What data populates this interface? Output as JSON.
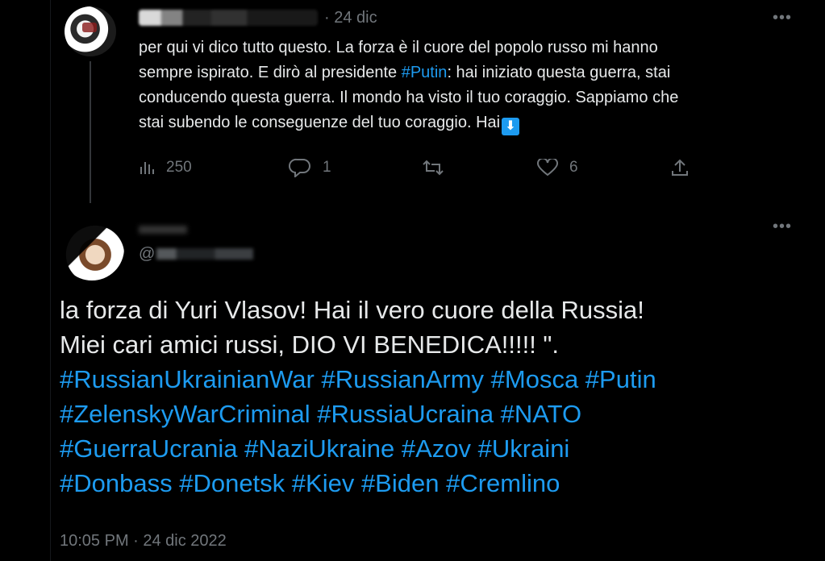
{
  "colors": {
    "background": "#000000",
    "text": "#e7e9ea",
    "muted": "#71767b",
    "link": "#1d9bf0"
  },
  "parent_tweet": {
    "date": "· 24 dic",
    "text_line1": "per qui vi dico tutto questo. La forza è il cuore del popolo russo mi hanno",
    "text_line2_a": "sempre ispirato. E dirò al presidente ",
    "text_line2_tag": "#Putin",
    "text_line2_b": ": hai iniziato questa guerra, stai",
    "text_line3": "conducendo questa guerra. Il mondo ha visto il tuo coraggio. Sappiamo che",
    "text_line4": "stai subendo le conseguenze del tuo coraggio. Hai",
    "emoji_icon": "down-arrow-emoji",
    "actions": {
      "views": "250",
      "replies": "1",
      "retweets": "",
      "likes": "6"
    }
  },
  "main_tweet": {
    "handle_prefix": "@",
    "text_line1": "la forza di Yuri Vlasov! Hai il vero cuore della Russia!",
    "text_line2": "Miei cari amici russi, DIO VI BENEDICA!!!!! \".",
    "hashtags_line1": "#RussianUkrainianWar #RussianArmy #Mosca #Putin",
    "hashtags_line2": "#ZelenskyWarCriminal #RussiaUcraina #NATO",
    "hashtags_line3": "#GuerraUcrania #NaziUkraine #Azov #Ukraini",
    "hashtags_line4": "#Donbass #Donetsk #Kiev #Biden #Cremlino",
    "timestamp": "10:05 PM · 24 dic 2022"
  },
  "icons": [
    "more-icon",
    "views-icon",
    "reply-icon",
    "retweet-icon",
    "like-icon",
    "share-icon"
  ]
}
